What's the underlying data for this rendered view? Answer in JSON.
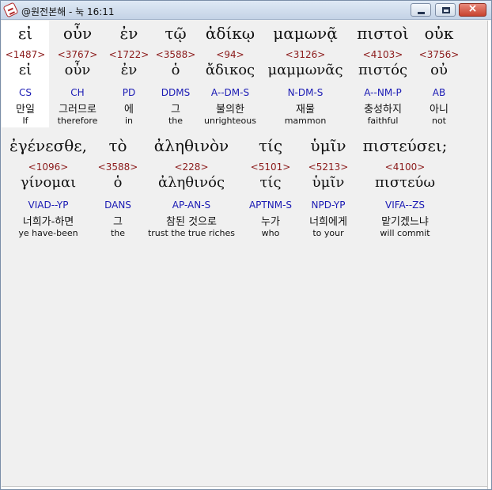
{
  "window": {
    "title": "@원전본해 - 눅 16:11"
  },
  "verse": {
    "line1": [
      {
        "greek": "εἰ",
        "strong": "<1487>",
        "lemma": "εἰ",
        "morph": "CS",
        "korean": "만일",
        "english": "If"
      },
      {
        "greek": "οὖν",
        "strong": "<3767>",
        "lemma": "οὖν",
        "morph": "CH",
        "korean": "그러므로",
        "english": "therefore"
      },
      {
        "greek": "ἐν",
        "strong": "<1722>",
        "lemma": "ἐν",
        "morph": "PD",
        "korean": "에",
        "english": "in"
      },
      {
        "greek": "τῷ",
        "strong": "<3588>",
        "lemma": "ὁ",
        "morph": "DDMS",
        "korean": "그",
        "english": "the"
      },
      {
        "greek": "ἀδίκῳ",
        "strong": "<94>",
        "lemma": "ἄδικος",
        "morph": "A--DM-S",
        "korean": "불의한",
        "english": "unrighteous"
      },
      {
        "greek": "μαμωνᾷ",
        "strong": "<3126>",
        "lemma": "μαμμωνᾶς",
        "morph": "N-DM-S",
        "korean": "재물",
        "english": "mammon"
      },
      {
        "greek": "πιστοὶ",
        "strong": "<4103>",
        "lemma": "πιστός",
        "morph": "A--NM-P",
        "korean": "충성하지",
        "english": "faithful"
      },
      {
        "greek": "οὐκ",
        "strong": "<3756>",
        "lemma": "οὐ",
        "morph": "AB",
        "korean": "아니",
        "english": "not"
      }
    ],
    "line2": [
      {
        "greek": "ἐγένεσθε,",
        "strong": "<1096>",
        "lemma": "γίνομαι",
        "morph": "VIAD--YP",
        "korean": "너희가-하면",
        "english": "ye have-been"
      },
      {
        "greek": "τὸ",
        "strong": "<3588>",
        "lemma": "ὁ",
        "morph": "DANS",
        "korean": "그",
        "english": "the"
      },
      {
        "greek": "ἀληθινὸν",
        "strong": "<228>",
        "lemma": "ἀληθινός",
        "morph": "AP-AN-S",
        "korean": "참된 것으로",
        "english": "trust the true riches"
      },
      {
        "greek": "τίς",
        "strong": "<5101>",
        "lemma": "τίς",
        "morph": "APTNM-S",
        "korean": "누가",
        "english": "who"
      },
      {
        "greek": "ὑμῖν",
        "strong": "<5213>",
        "lemma": "ὑμῖν",
        "morph": "NPD-YP",
        "korean": "너희에게",
        "english": "to your"
      },
      {
        "greek": "πιστεύσει;",
        "strong": "<4100>",
        "lemma": "πιστεύω",
        "morph": "VIFA--ZS",
        "korean": "맡기겠느냐",
        "english": "will commit"
      }
    ]
  }
}
